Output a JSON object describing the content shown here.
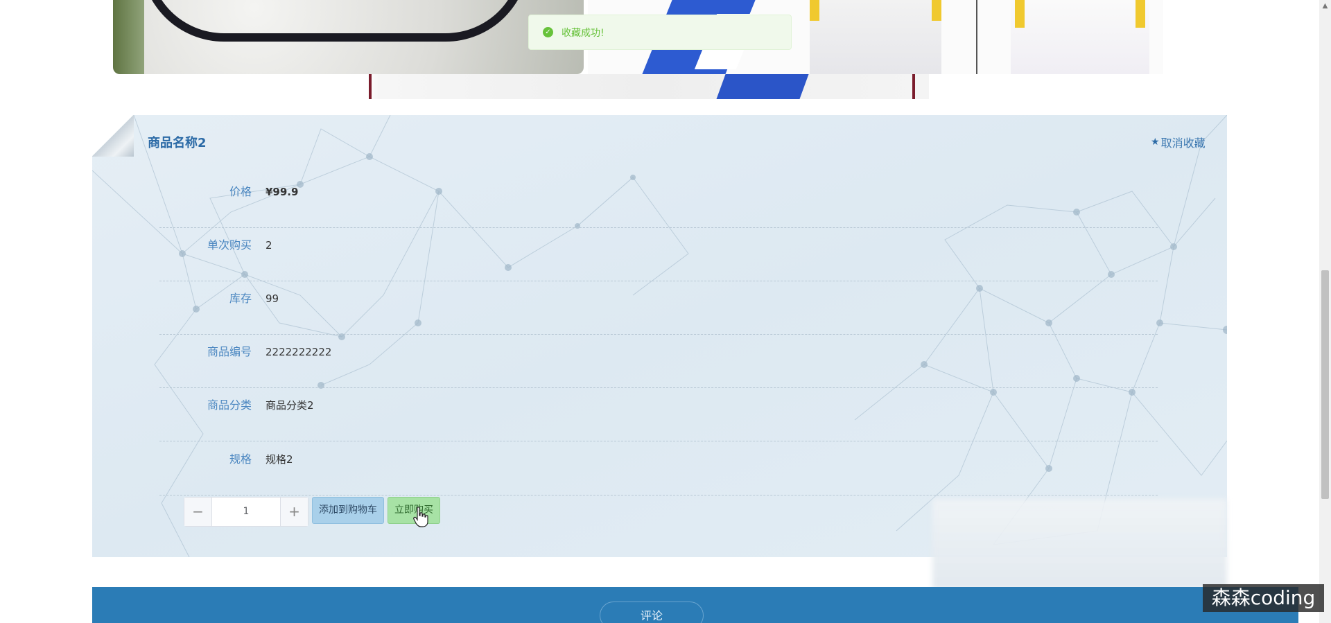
{
  "toast": {
    "icon": "check-circle-icon",
    "message": "收藏成功!"
  },
  "product": {
    "name": "商品名称2",
    "favorite_label": "取消收藏",
    "favorite_icon": "star-icon",
    "details": [
      {
        "label": "价格",
        "value": "¥99.9"
      },
      {
        "label": "单次购买",
        "value": "2"
      },
      {
        "label": "库存",
        "value": "99"
      },
      {
        "label": "商品编号",
        "value": "2222222222"
      },
      {
        "label": "商品分类",
        "value": "商品分类2"
      },
      {
        "label": "规格",
        "value": "规格2"
      }
    ]
  },
  "purchase": {
    "decrement_symbol": "−",
    "quantity": "1",
    "increment_symbol": "+",
    "add_to_cart_label": "添加到购物车",
    "buy_now_label": "立即购买"
  },
  "comments": {
    "tab_label": "评论"
  },
  "watermark": "森森coding",
  "colors": {
    "accent": "#2b7cb6",
    "success": "#67c23a",
    "label": "#4a86c0"
  }
}
